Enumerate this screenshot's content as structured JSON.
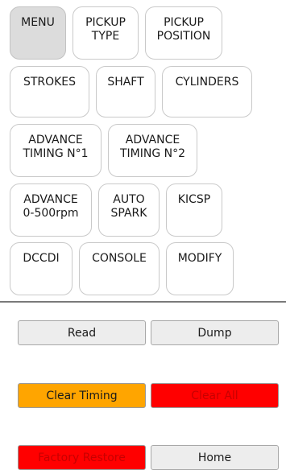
{
  "menu_grid": {
    "menu": [
      "MENU"
    ],
    "pickup_type": [
      "PICKUP",
      "TYPE"
    ],
    "pickup_position": [
      "PICKUP",
      "POSITION"
    ],
    "strokes": [
      "STROKES"
    ],
    "shaft": [
      "SHAFT"
    ],
    "cylinders": [
      "CYLINDERS"
    ],
    "advance_timing_1": [
      "ADVANCE",
      "TIMING N°1"
    ],
    "advance_timing_2": [
      "ADVANCE",
      "TIMING N°2"
    ],
    "advance_0_500": [
      "ADVANCE",
      "0-500rpm"
    ],
    "auto_spark": [
      "AUTO",
      "SPARK"
    ],
    "kicsp": [
      "KICSP"
    ],
    "dccdi": [
      "DCCDI"
    ],
    "console": [
      "CONSOLE"
    ],
    "modify": [
      "MODIFY"
    ]
  },
  "actions": {
    "read": "Read",
    "dump": "Dump",
    "clear_timing": "Clear Timing",
    "clear_all": "Clear All",
    "factory_restore": "Factory Restore",
    "home": "Home"
  },
  "colors": {
    "active_tile": "#dcdcdc",
    "clear_timing_bg": "#ffa500",
    "danger_bg": "#ff0000",
    "danger_text": "#c80000"
  }
}
